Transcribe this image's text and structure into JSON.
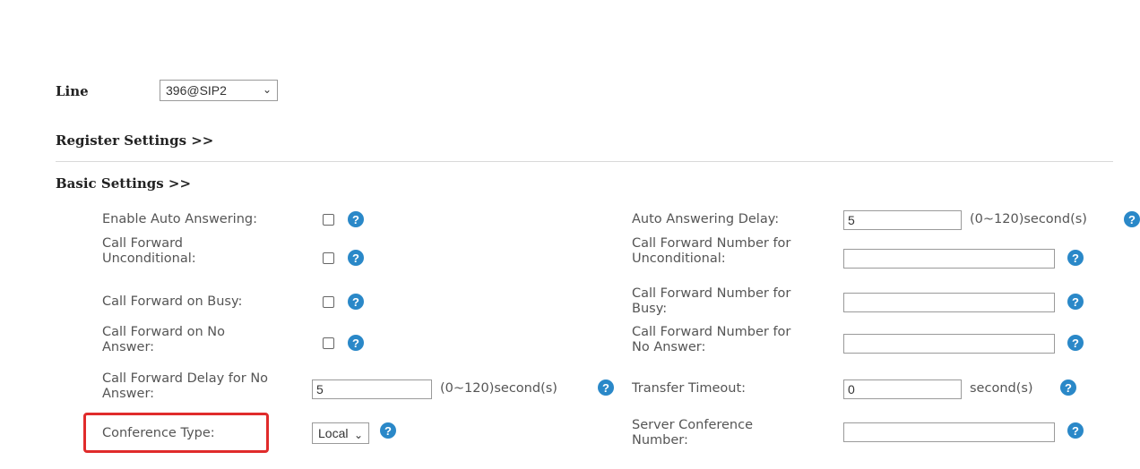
{
  "line": {
    "label": "Line",
    "selected": "396@SIP2"
  },
  "register_settings": {
    "title": "Register Settings >>"
  },
  "basic_settings": {
    "title": "Basic Settings >>",
    "help_icon": "?",
    "enable_auto_answering": {
      "label": "Enable Auto Answering:"
    },
    "auto_answering_delay": {
      "label": "Auto Answering Delay:",
      "value": "5",
      "unit": "(0~120)second(s)"
    },
    "call_forward_unconditional": {
      "label_1": "Call Forward",
      "label_2": "Unconditional:"
    },
    "call_forward_number_unconditional": {
      "label_1": "Call Forward Number for",
      "label_2": "Unconditional:",
      "value": ""
    },
    "call_forward_on_busy": {
      "label": "Call Forward on Busy:"
    },
    "call_forward_number_busy": {
      "label_1": "Call Forward Number for",
      "label_2": "Busy:",
      "value": ""
    },
    "call_forward_on_no_answer": {
      "label_1": "Call Forward on No",
      "label_2": "Answer:"
    },
    "call_forward_number_no_answer": {
      "label_1": "Call Forward Number for",
      "label_2": "No Answer:",
      "value": ""
    },
    "call_forward_delay": {
      "label_1": "Call Forward Delay for No",
      "label_2": "Answer:",
      "value": "5",
      "unit": "(0~120)second(s)"
    },
    "transfer_timeout": {
      "label": "Transfer Timeout:",
      "value": "0",
      "unit": "second(s)"
    },
    "conference_type": {
      "label": "Conference Type:",
      "selected": "Local"
    },
    "server_conference_number": {
      "label_1": "Server Conference",
      "label_2": "Number:",
      "value": ""
    }
  },
  "colors": {
    "help_icon": "#2a88c8",
    "highlight": "#e02b2b"
  }
}
